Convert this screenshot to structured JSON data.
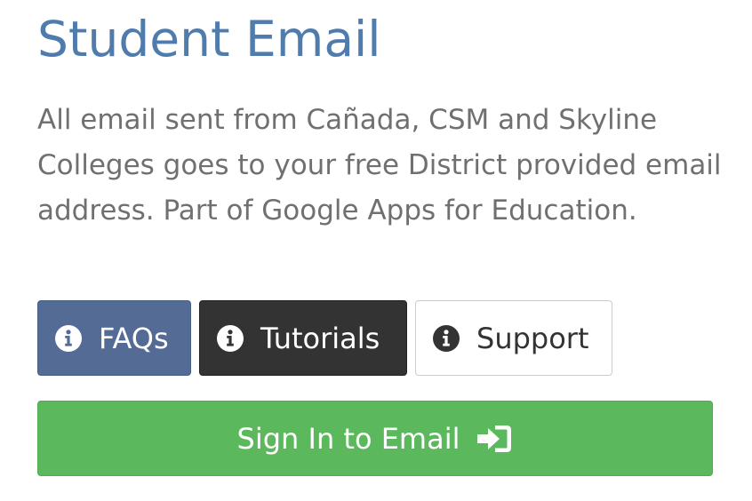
{
  "heading": {
    "title": "Student Email"
  },
  "description": {
    "text": "All email sent from Cañada, CSM and Skyline Colleges goes to your free District provided email address. Part of Google Apps for Education."
  },
  "buttons": {
    "faqs_label": "FAQs",
    "tutorials_label": "Tutorials",
    "support_label": "Support",
    "signin_label": "Sign In to Email"
  },
  "icons": {
    "info": "info-circle-icon",
    "signin": "sign-in-icon"
  },
  "colors": {
    "title": "#4f7cac",
    "faqs_bg": "#536b95",
    "tutorials_bg": "#333333",
    "support_bg": "#ffffff",
    "signin_bg": "#5cb85c"
  }
}
